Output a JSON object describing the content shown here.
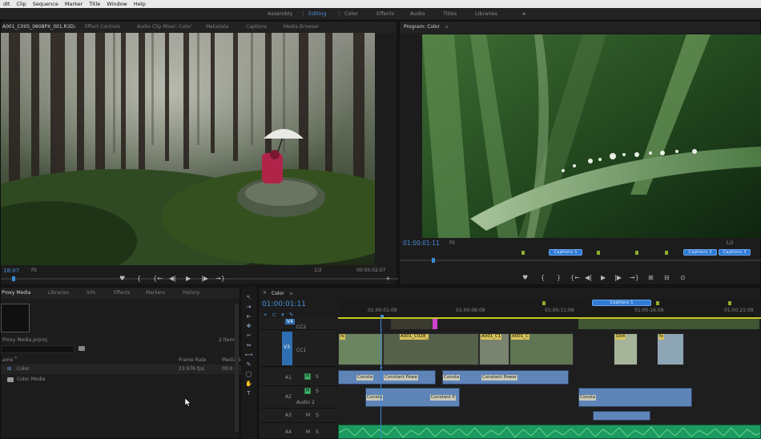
{
  "menu": [
    "dit",
    "Clip",
    "Sequence",
    "Marker",
    "Title",
    "Window",
    "Help"
  ],
  "workspaces": {
    "tabs": [
      "Assembly",
      "Editing",
      "Color",
      "Effects",
      "Audio",
      "Titles",
      "Libraries"
    ],
    "active": "Editing",
    "overflow": "»"
  },
  "source_monitor": {
    "tabs": [
      "A001_C005_0608PX_001.R3D",
      "Effect Controls",
      "Audio Clip Mixer: Color",
      "Metadata",
      "Captions",
      "Media Browser"
    ],
    "menu_icon": "≡",
    "timecode_in": "18:07",
    "fit": "Fit",
    "resolution": "1/2",
    "duration": "00:00:02:07",
    "image_desc": "misty forest with person holding umbrella"
  },
  "program_monitor": {
    "title": "Program: Color",
    "menu_icon": "≡",
    "timecode": "01:00:01:11",
    "fit": "Fit",
    "resolution": "1/2",
    "captions": [
      "Captions 1",
      "Captions 2",
      "Captions 3"
    ],
    "image_desc": "water droplets on grass blade"
  },
  "transport_glyphs": {
    "marker": "♥",
    "in": "{",
    "out": "}",
    "goto_in": "{←",
    "step_back": "◀|",
    "play": "▶",
    "step_fwd": "|▶",
    "goto_out": "→}",
    "insert": "⊞",
    "overwrite": "⊟",
    "export": "⊙",
    "add": "+"
  },
  "project_panel": {
    "tabs": [
      "Proxy Media",
      "Libraries",
      "Info",
      "Effects",
      "Markers",
      "History"
    ],
    "project_file": "Proxy Media.prproj",
    "item_count": "2 Items",
    "col_name": "ame",
    "col_framerate": "Frame Rate",
    "col_media": "Media S",
    "rows": [
      {
        "name": "Color",
        "framerate": "23.976 fps",
        "media": "00:0"
      },
      {
        "name": "Color Media",
        "framerate": "",
        "media": ""
      }
    ]
  },
  "timeline": {
    "close_glyph": "×",
    "sequence_name": "Color",
    "menu_icon": "≡",
    "timecode": "01:00:01:11",
    "ruler": [
      "01:00:01:09",
      "01:00:06:09",
      "01:00:11:09",
      "01:00:16:09",
      "01:00:21:09"
    ],
    "caption_top": "Captions 1",
    "tracks": {
      "V4": "V4",
      "V3": "V3",
      "cc2": "CC2",
      "cc1": "CC1",
      "A1": "A1",
      "A2": "A2",
      "A2_name": "Audio 2",
      "A3": "A3",
      "A4": "A4"
    },
    "toggle_M": "M",
    "toggle_S": "S",
    "clips": {
      "v_a001_c028": "A001_C028_",
      "v_a001_c1a": "A001_C1",
      "v_a001_c1b": "A001_C",
      "v_d04": "D04",
      "v_fx1": "fx",
      "v_fx2": "fx"
    },
    "transitions": {
      "t1": "Consta",
      "t2": "Constant Powe",
      "t3": "Consta",
      "t4": "Constant Power",
      "t5": "Consta",
      "t6": "Constant P",
      "t7": "Consta"
    }
  },
  "tools": [
    "↖",
    "⇥",
    "⇤",
    "✥",
    "✂",
    "⇔",
    "⟷",
    "✎",
    "◯",
    "✋",
    "T"
  ],
  "colors": {
    "accent_blue": "#4a90d9",
    "audio_blue": "#5f84b8",
    "audio_green": "#1c9a5f",
    "caption_blue": "#2f7bd6",
    "marker_green": "#8fae2a",
    "playhead": "#3a8ad8"
  }
}
